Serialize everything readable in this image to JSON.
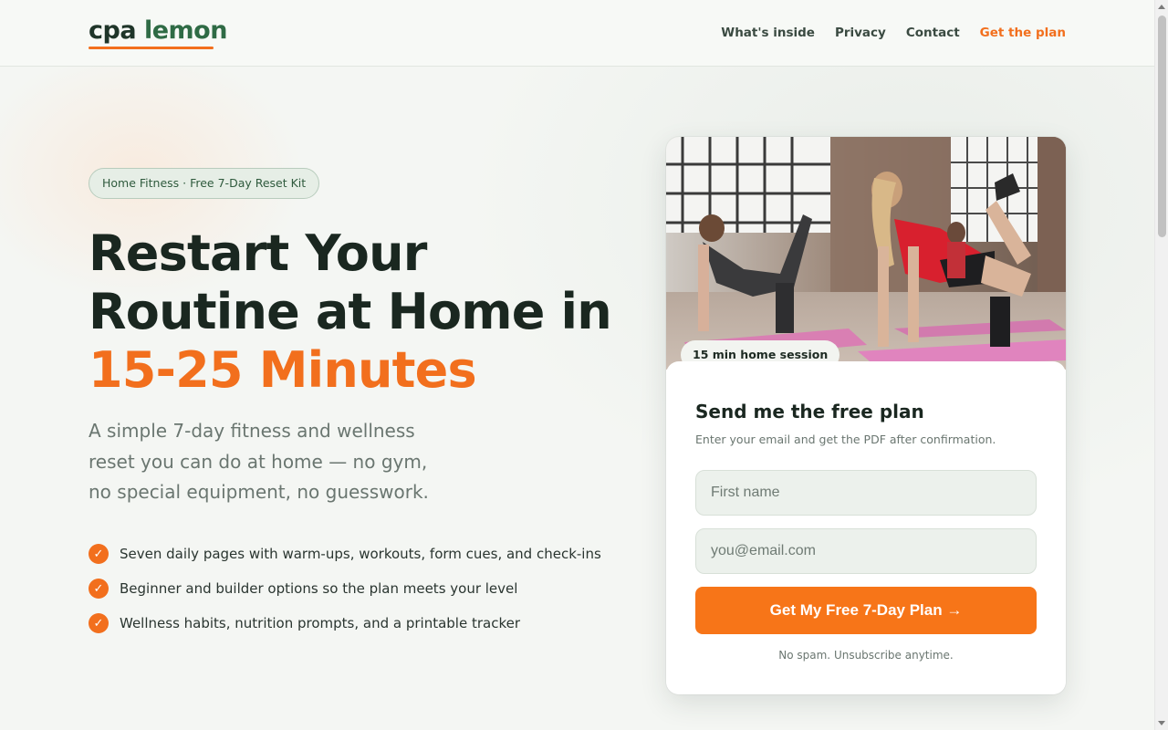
{
  "header": {
    "logo_word1": "cpa",
    "logo_word2": "lemon",
    "nav": [
      "What's inside",
      "Privacy",
      "Contact",
      "Get the plan"
    ]
  },
  "hero": {
    "badge": "Home Fitness · Free 7-Day Reset Kit",
    "headline_part1": "Restart Your Routine at Home in ",
    "headline_accent": "15-25 Minutes",
    "subtitle": "A simple 7-day fitness and wellness reset you can do at home — no gym, no special equipment, no guesswork.",
    "features": [
      "Seven daily pages with warm-ups, workouts, form cues, and check-ins",
      "Beginner and builder options so the plan meets your level",
      "Wellness habits, nutrition prompts, and a printable tracker"
    ]
  },
  "card": {
    "photo_tag": "15 min home session",
    "form_title": "Send me the free plan",
    "form_subtitle": "Enter your email and get the PDF after confirmation.",
    "first_name_placeholder": "First name",
    "email_placeholder": "you@email.com",
    "submit_label": "Get My Free 7-Day Plan →",
    "note": "No spam. Unsubscribe anytime."
  },
  "colors": {
    "accent": "#f26f1d",
    "brand_green": "#2f6b45",
    "text_dark": "#1a2720"
  }
}
